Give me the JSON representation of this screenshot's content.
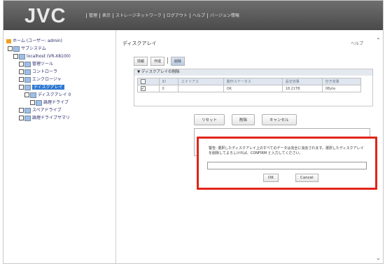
{
  "header": {
    "logo": "JVC",
    "nav": [
      "管理",
      "表示",
      "ストレージネットワーク",
      "ログアウト",
      "ヘルプ",
      "バージョン情報"
    ]
  },
  "tree": [
    {
      "label": "ホーム (ユーザー: admin)",
      "indent": 0,
      "icon": "home-icon"
    },
    {
      "label": "サブシステム",
      "indent": 1,
      "icon": "folder-icon"
    },
    {
      "label": "localhost (VR-X8100)",
      "indent": 2,
      "icon": "server-icon"
    },
    {
      "label": "管理ツール",
      "indent": 3,
      "icon": "tool-icon"
    },
    {
      "label": "コントローラ",
      "indent": 3,
      "icon": "controller-icon"
    },
    {
      "label": "エンクロージャ",
      "indent": 3,
      "icon": "enclosure-icon"
    },
    {
      "label": "ディスクアレイ",
      "indent": 3,
      "icon": "disk-array-icon",
      "selected": true
    },
    {
      "label": "ディスクアレイ 0",
      "indent": 4,
      "icon": "disk-array-icon"
    },
    {
      "label": "論理ドライブ",
      "indent": 5,
      "icon": "logical-drive-icon"
    },
    {
      "label": "スペアドライブ",
      "indent": 3,
      "icon": "spare-drive-icon"
    },
    {
      "label": "論理ドライブサマリ",
      "indent": 3,
      "icon": "summary-icon"
    }
  ],
  "main": {
    "title": "ディスクアレイ",
    "help": "ヘルプ",
    "toolbar": [
      "情報",
      "作成",
      "削除"
    ],
    "section_title": "ディスクアレイの削除",
    "columns": [
      "",
      "ID",
      "エイリアス",
      "動作ステータス",
      "設定容量",
      "空き容量"
    ],
    "rows": [
      [
        "",
        "0",
        "",
        "OK",
        "18.21TB",
        "0Byte"
      ]
    ],
    "buttons": [
      "リセット",
      "削除",
      "キャンセル"
    ]
  },
  "dialog": {
    "warning": "警告: 選択したディスクアレイ上のすべてのデータは完全に消去されます。選択したディスクアレイを削除してよろしければ、CONFIRM と入力してください。",
    "input_value": "",
    "ok": "OK",
    "cancel": "Cancel"
  },
  "colors": {
    "highlight_border": "#e0261a",
    "selected_item": "#2f79d0"
  }
}
